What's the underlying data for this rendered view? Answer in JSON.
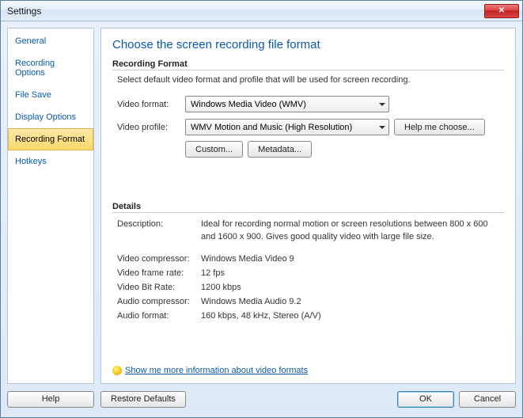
{
  "window": {
    "title": "Settings"
  },
  "sidebar": {
    "items": [
      {
        "label": "General"
      },
      {
        "label": "Recording Options"
      },
      {
        "label": "File Save"
      },
      {
        "label": "Display Options"
      },
      {
        "label": "Recording Format"
      },
      {
        "label": "Hotkeys"
      }
    ],
    "selected_index": 4
  },
  "page": {
    "title": "Choose the screen recording file format",
    "format_group": {
      "heading": "Recording Format",
      "subtext": "Select default video format and profile that will be used for screen recording.",
      "video_format_label": "Video format:",
      "video_format_value": "Windows Media Video (WMV)",
      "video_profile_label": "Video profile:",
      "video_profile_value": "WMV Motion and Music (High Resolution)",
      "help_choose": "Help me choose...",
      "custom_btn": "Custom...",
      "metadata_btn": "Metadata..."
    },
    "details_group": {
      "heading": "Details",
      "rows": [
        {
          "label": "Description:",
          "value": "Ideal for recording normal motion or screen resolutions between 800 x 600 and 1600 x 900. Gives good quality video with large file size."
        },
        {
          "label": "Video compressor:",
          "value": "Windows Media Video 9"
        },
        {
          "label": "Video frame rate:",
          "value": "12 fps"
        },
        {
          "label": "Video Bit Rate:",
          "value": "1200 kbps"
        },
        {
          "label": "Audio compressor:",
          "value": "Windows Media Audio 9.2"
        },
        {
          "label": "Audio format:",
          "value": "160 kbps, 48 kHz, Stereo (A/V)"
        }
      ],
      "link": "Show me more information about video formats"
    }
  },
  "footer": {
    "help": "Help",
    "restore": "Restore Defaults",
    "ok": "OK",
    "cancel": "Cancel"
  }
}
